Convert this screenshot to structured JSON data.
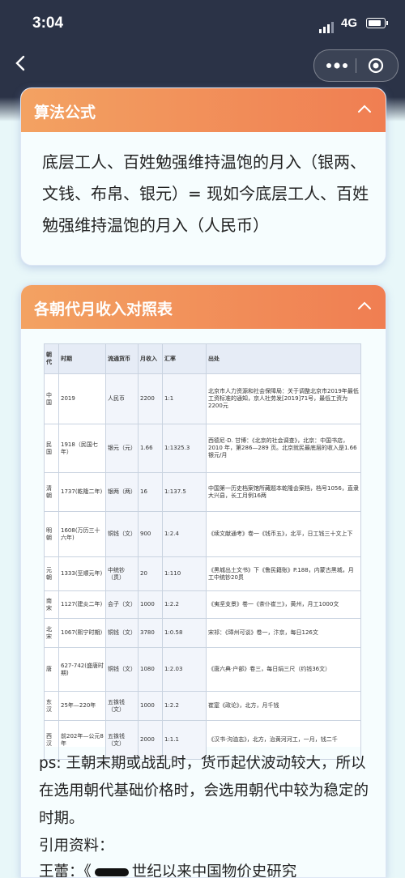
{
  "status": {
    "time": "3:04",
    "network": "4G"
  },
  "nav": {
    "back_icon": "chevron-left-icon",
    "more_icon": "more-dots-icon",
    "close_icon": "target-ring-icon"
  },
  "card1": {
    "title": "算法公式",
    "formula": "底层工人、百姓勉强维持温饱的月入（银两、文钱、布帛、银元）= 现如今底层工人、百姓勉强维持温饱的月入（人民币）"
  },
  "card2": {
    "title": "各朝代月收入对照表",
    "table": {
      "headers": [
        "朝代",
        "时期",
        "流通货币",
        "月收入",
        "汇率",
        "出处"
      ],
      "rows": [
        [
          "中国",
          "2019",
          "人民币",
          "2200",
          "1:1",
          "北京市人力资源和社会保障局：关于调整北京市2019年最低工资标准的通知，京人社劳发[2019]71号，最低工资为2200元"
        ],
        [
          "民国",
          "1918（民国七年）",
          "银元（元）",
          "1.66",
          "1:1325.3",
          "西德尼·D. 甘博：《北京的社会调查》，北京：中国书店，2010 年，第286—289 页。北京就民最底层的收入是1.66银元/月"
        ],
        [
          "清朝",
          "1737(乾隆二年)",
          "银两（两）",
          "16",
          "1:137.5",
          "中国第一历史档案馆所藏题本乾隆会案档，档号1056，直隶大兴县，长工月例16两"
        ],
        [
          "明朝",
          "1608(万历三十六年)",
          "铜钱（文）",
          "900",
          "1:2.4",
          "《续文献通考》卷一《钱币五》，北平，日工钱三十文上下"
        ],
        [
          "元朝",
          "1333(至顺元年)",
          "中统钞（贯）",
          "20",
          "1:110",
          "《黑城出土文书》下《鲁民籍账》P.188，内蒙古黑城，月工中统钞20贯"
        ],
        [
          "南宋",
          "1127(建炎二年)",
          "会子（文）",
          "1000",
          "1:2.2",
          "《夷坚支景》卷一《茶仆崔三》，黄州，月工1000文"
        ],
        [
          "北宋",
          "1067(熙宁时期)",
          "铜钱（文）",
          "3780",
          "1:0.58",
          "宋祁：《璋州可谈》卷一，汴京，每日126文"
        ],
        [
          "唐",
          "627-742(盛唐时期)",
          "铜钱（文）",
          "1080",
          "1:2.03",
          "《唐六典·户部》卷三，每日绢三尺（约钱36文）"
        ],
        [
          "东汉",
          "25年—220年",
          "五铢钱（文）",
          "1000",
          "1:2.2",
          "崔寔《政论》，北方，月千钱"
        ],
        [
          "西汉",
          "前202年—公元8年",
          "五铢钱（文）",
          "2000",
          "1:1.1",
          "《汉书·沟洫志》，北方，治黄河河工，一月，钱二千"
        ]
      ]
    },
    "note": "ps: 王朝末期或战乱时，货币起伏波动较大，所以在选用朝代基础价格时，会选用朝代中较为稳定的时期。",
    "ref_label": "引用资料：",
    "ref_prefix": "王蕾：《",
    "ref_suffix": "世纪以来中国物价史研究"
  }
}
